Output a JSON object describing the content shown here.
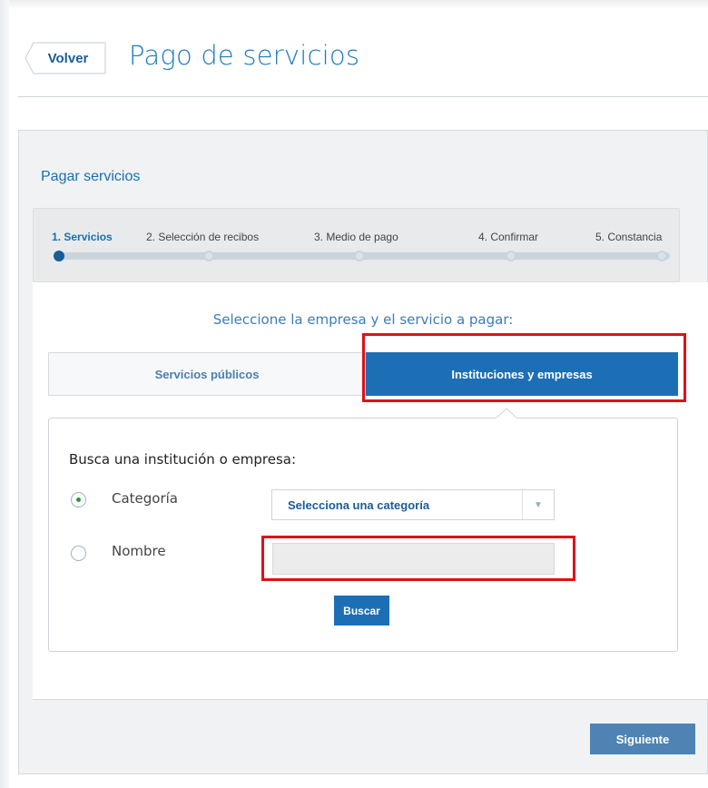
{
  "header": {
    "back_label": "Volver",
    "title": "Pago de servicios"
  },
  "panel": {
    "title": "Pagar servicios"
  },
  "stepper": {
    "steps": [
      {
        "label": "1. Servicios",
        "active": true
      },
      {
        "label": "2. Selección de recibos",
        "active": false
      },
      {
        "label": "3. Medio de pago",
        "active": false
      },
      {
        "label": "4. Confirmar",
        "active": false
      },
      {
        "label": "5. Constancia",
        "active": false
      }
    ]
  },
  "content": {
    "prompt": "Seleccione la empresa y el servicio a pagar:",
    "tabs": [
      {
        "label": "Servicios públicos",
        "selected": false
      },
      {
        "label": "Instituciones y empresas",
        "selected": true
      }
    ]
  },
  "search_form": {
    "heading": "Busca una institución o empresa:",
    "options": [
      {
        "label": "Categoría",
        "checked": true
      },
      {
        "label": "Nombre",
        "checked": false
      }
    ],
    "category_select_value": "Selecciona una categoría",
    "name_input_value": "",
    "search_button_label": "Buscar"
  },
  "footer": {
    "next_label": "Siguiente"
  },
  "colors": {
    "accent": "#1d6fb5",
    "title_blue": "#1c7ac0",
    "highlight_red": "#e0101a",
    "radio_checked": "#1e9d3a"
  }
}
